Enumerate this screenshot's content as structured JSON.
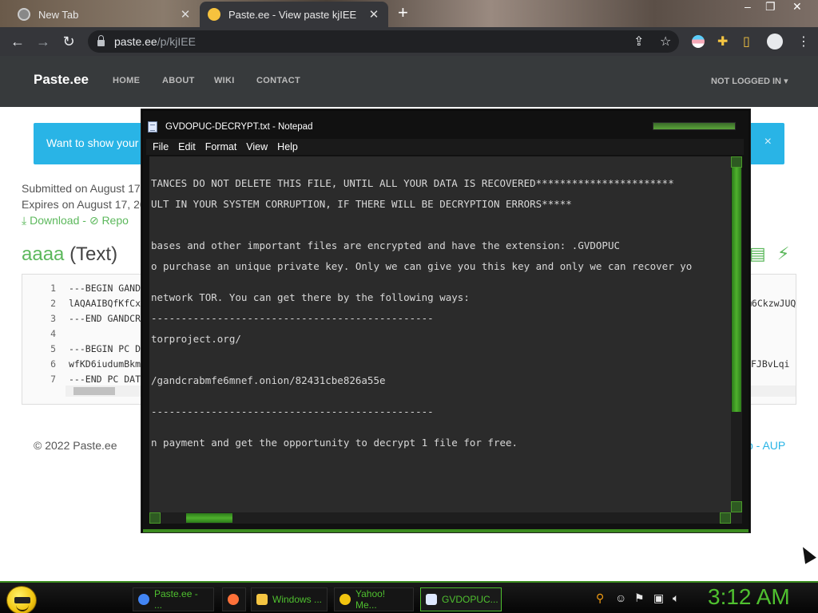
{
  "browser": {
    "tabs": [
      {
        "title": "New Tab",
        "active": false
      },
      {
        "title": "Paste.ee - View paste kjIEE",
        "active": true
      }
    ],
    "new_tab_label": "+",
    "window_controls": [
      "–",
      "❐",
      "✕"
    ],
    "address": {
      "host": "paste.ee",
      "path": "/p/kjIEE"
    },
    "nav": {
      "back": "←",
      "forward": "→",
      "reload": "↻"
    },
    "toolbar_icons": [
      "share-icon",
      "star-icon",
      "extension-icon",
      "puzzle-icon",
      "sidepanel-icon",
      "profile-icon",
      "menu-icon"
    ]
  },
  "site": {
    "brand": "Paste.ee",
    "nav": [
      "HOME",
      "ABOUT",
      "WIKI",
      "CONTACT"
    ],
    "account": "NOT LOGGED IN",
    "alert": "Want to show your",
    "alert_close": "×",
    "submitted": "Submitted on August 17",
    "expires": "Expires on August 17, 20",
    "download": "Download",
    "report": "Repo",
    "link_separator": "-",
    "paste_name": "aaaa",
    "paste_type": "(Text)",
    "code_lines": [
      {
        "n": "1",
        "text": "---BEGIN GAND",
        "tail": ""
      },
      {
        "n": "2",
        "text": "lAQAAIBQfKfCx",
        "tail": "@6CkzwJUQ"
      },
      {
        "n": "3",
        "text": "---END GANDCR",
        "tail": ""
      },
      {
        "n": "4",
        "text": "",
        "tail": ""
      },
      {
        "n": "5",
        "text": "---BEGIN PC D",
        "tail": ""
      },
      {
        "n": "6",
        "text": "wfKD6iudumBkm",
        "tail": "FJBvLqi"
      },
      {
        "n": "7",
        "text": "---END PC DAT",
        "tail": ""
      }
    ],
    "code_overflow": "ge",
    "footer": "© 2022 Paste.ee",
    "footer_right": "p - AUP"
  },
  "notepad": {
    "title": "GVDOPUC-DECRYPT.txt - Notepad",
    "menus": [
      "File",
      "Edit",
      "Format",
      "View",
      "Help"
    ],
    "lines": [
      "TANCES DO NOT DELETE THIS FILE, UNTIL ALL YOUR DATA IS RECOVERED***********************",
      "ULT IN YOUR SYSTEM CORRUPTION, IF THERE WILL BE DECRYPTION ERRORS*****",
      "",
      "bases and other important files are encrypted and have the extension: .GVDOPUC",
      "o purchase an unique private key. Only we can give you this key and only we can recover yo",
      "network TOR. You can get there by the following ways:",
      "-----------------------------------------------",
      "torproject.org/",
      "/gandcrabmfe6mnef.onion/82431cbe826a55e",
      "-----------------------------------------------",
      "n payment and get the opportunity to decrypt 1 file for free."
    ]
  },
  "taskbar": {
    "buttons": [
      {
        "label": "Paste.ee - ...",
        "color": "#4285f4"
      },
      {
        "label": "",
        "color": "#ff7139"
      },
      {
        "label": "Windows ...",
        "color": "#f5c542"
      },
      {
        "label": "Yahoo! Me...",
        "color": "#f1c40f"
      },
      {
        "label": "GVDOPUC...",
        "color": "#dfe9ff"
      }
    ],
    "clock": "3:12 AM",
    "tray_icons": [
      "search-icon",
      "emoji-icon",
      "flag-icon",
      "network-icon",
      "volume-icon"
    ]
  },
  "colors": {
    "accent_green": "#4fc02f",
    "paste_green": "#5cb85c",
    "alert_blue": "#29b4e6",
    "navbar": "#373a3c"
  }
}
